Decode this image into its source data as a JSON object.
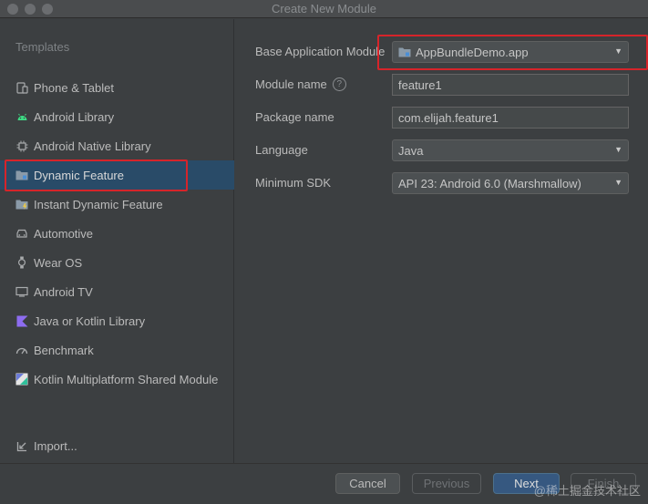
{
  "window": {
    "title": "Create New Module"
  },
  "sidebar": {
    "heading": "Templates",
    "items": [
      {
        "label": "Phone & Tablet",
        "icon": "phone-tablet-icon"
      },
      {
        "label": "Android Library",
        "icon": "android-icon"
      },
      {
        "label": "Android Native Library",
        "icon": "native-library-icon"
      },
      {
        "label": "Dynamic Feature",
        "icon": "folder-icon",
        "selected": true
      },
      {
        "label": "Instant Dynamic Feature",
        "icon": "instant-feature-icon"
      },
      {
        "label": "Automotive",
        "icon": "car-icon"
      },
      {
        "label": "Wear OS",
        "icon": "watch-icon"
      },
      {
        "label": "Android TV",
        "icon": "tv-icon"
      },
      {
        "label": "Java or Kotlin Library",
        "icon": "kotlin-icon"
      },
      {
        "label": "Benchmark",
        "icon": "gauge-icon"
      },
      {
        "label": "Kotlin Multiplatform Shared Module",
        "icon": "kotlin-multiplatform-icon"
      }
    ],
    "import_label": "Import..."
  },
  "form": {
    "base_module": {
      "label": "Base Application Module",
      "value": "AppBundleDemo.app"
    },
    "module_name": {
      "label": "Module name",
      "value": "feature1"
    },
    "package_name": {
      "label": "Package name",
      "value": "com.elijah.feature1"
    },
    "language": {
      "label": "Language",
      "value": "Java"
    },
    "min_sdk": {
      "label": "Minimum SDK",
      "value": "API 23: Android 6.0 (Marshmallow)"
    }
  },
  "footer": {
    "cancel": "Cancel",
    "previous": "Previous",
    "next": "Next",
    "finish": "Finish"
  },
  "watermark": "@稀土掘金技术社区",
  "colors": {
    "background": "#3c3f41",
    "selection": "#294b68",
    "highlight": "#d6242a",
    "primary_button": "#365880"
  }
}
